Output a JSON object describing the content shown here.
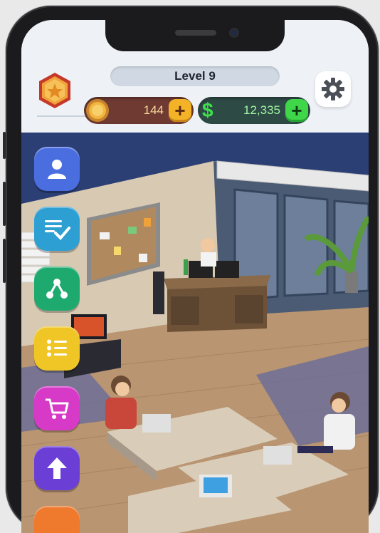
{
  "hud": {
    "level_label": "Level 9",
    "coins": "144",
    "cash": "12,335",
    "coin_plus": "+",
    "cash_plus": "+",
    "cash_symbol": "$"
  },
  "colors": {
    "coin_bar": "#6e3a32",
    "cash_bar": "#2e4a45",
    "coin_plus": "#f4b227",
    "cash_plus": "#3fd64a"
  },
  "side_menu": [
    {
      "icon": "profile-icon",
      "color": "#4a6ee0"
    },
    {
      "icon": "task-checklist-icon",
      "color": "#2e9fd3"
    },
    {
      "icon": "network-icon",
      "color": "#1eaa6e"
    },
    {
      "icon": "list-icon",
      "color": "#f0c626"
    },
    {
      "icon": "shop-cart-icon",
      "color": "#d83ac8"
    },
    {
      "icon": "upgrade-arrow-icon",
      "color": "#6b3fd6"
    }
  ]
}
